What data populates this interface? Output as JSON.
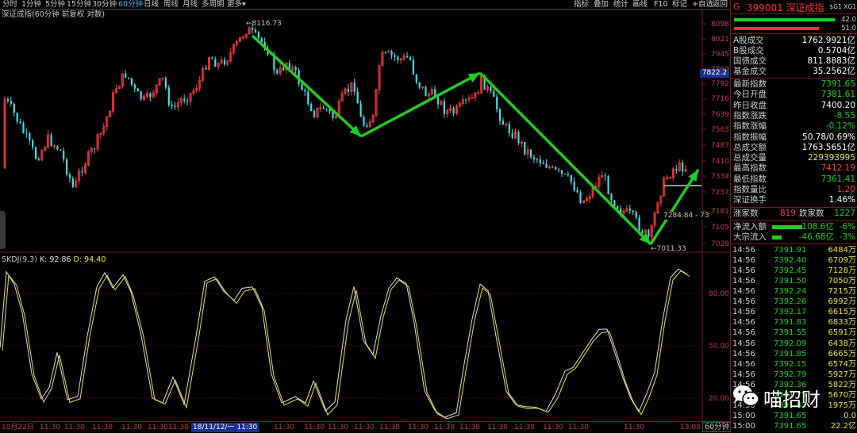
{
  "toolbar": {
    "timeframes": [
      "分时",
      "1分钟",
      "5分钟",
      "15分钟",
      "30分钟",
      "60分钟",
      "日线",
      "周线",
      "月线",
      "多周期",
      "更多"
    ],
    "active": "60分钟",
    "tools": [
      "指标",
      "叠加",
      "统计",
      "画线",
      "F10",
      "标记",
      "+自选",
      "返回"
    ]
  },
  "chart": {
    "title": "深证成指(60分钟 前复权 对数)",
    "peak_label": "8116.73",
    "low_label": "7011.33",
    "right_label": "7284.84 - 73",
    "current_price": "7822.2",
    "y_ticks": [
      "8098",
      "8021",
      "7945",
      "7869",
      "7792",
      "7716",
      "7639",
      "7563",
      "7487",
      "7410",
      "7334",
      "7257",
      "7181",
      "7105",
      "7028"
    ],
    "kdj_title": "SKDJ(9,3)",
    "kdj_k": "K: 92.86",
    "kdj_d": "D: 94.40",
    "kdj_ticks": [
      "80.00",
      "50.00",
      "20.00"
    ],
    "x_labels": [
      "10月22日",
      "11:30",
      "11:30",
      "11:30",
      "11:30",
      "11:30",
      "11:30",
      "18/11/12/一 11:30",
      "11:30",
      "11:30",
      "11:30",
      "11:30",
      "11:30",
      "11:30",
      "11:30",
      "11:30",
      "11:30",
      "11:30",
      "11:30",
      "11:30",
      "11:30",
      "13:00"
    ],
    "period_label": "60分钟",
    "colors": {
      "up": "#ff3c3c",
      "down": "#40e0e8",
      "trend": "#22cc22",
      "k_line": "#e0e0e0",
      "d_line": "#e8e845"
    }
  },
  "panel": {
    "g": "G",
    "title": "399001 深证成指",
    "tag": "$G1 XG1",
    "bar_top_val": "42.0",
    "bar_bottom_val": "51.0",
    "volumes": [
      {
        "label": "A股成交",
        "value": "1762.9921亿"
      },
      {
        "label": "B股成交",
        "value": "0.5704亿"
      },
      {
        "label": "国债成交",
        "value": "811.8883亿"
      },
      {
        "label": "基金成交",
        "value": "35.2562亿"
      }
    ],
    "quotes": [
      {
        "label": "最新指数",
        "value": "7391.65",
        "color": "green"
      },
      {
        "label": "今日开盘",
        "value": "7381.61",
        "color": "green"
      },
      {
        "label": "昨日收盘",
        "value": "7400.20",
        "color": "white"
      },
      {
        "label": "指数涨跌",
        "value": "-8.55",
        "color": "green"
      },
      {
        "label": "指数涨幅",
        "value": "-0.12%",
        "color": "green"
      },
      {
        "label": "指数振幅",
        "value": "50.78/0.69%",
        "color": "white"
      },
      {
        "label": "总成交额",
        "value": "1763.5651亿",
        "color": "white"
      },
      {
        "label": "总成交量",
        "value": "229393995",
        "color": "yellow"
      },
      {
        "label": "最高指数",
        "value": "7412.19",
        "color": "red"
      },
      {
        "label": "最低指数",
        "value": "7361.41",
        "color": "green"
      },
      {
        "label": "指数量比",
        "value": "1.20",
        "color": "red"
      },
      {
        "label": "深证换手",
        "value": "1.46%",
        "color": "white"
      }
    ],
    "breadth": {
      "up_label": "涨家数",
      "up": "819",
      "down_label": "跌家数",
      "down": "1227"
    },
    "flows": [
      {
        "label": "净流入额",
        "value": "-108.6亿",
        "pct": "-6%"
      },
      {
        "label": "大宗流入",
        "value": "-46.68亿",
        "pct": "-3%"
      }
    ],
    "ticks": [
      {
        "t": "14:56",
        "p": "7391.91",
        "q": "6484万"
      },
      {
        "t": "14:56",
        "p": "7392.40",
        "q": "6709万"
      },
      {
        "t": "14:56",
        "p": "7392.45",
        "q": "7128万"
      },
      {
        "t": "14:56",
        "p": "7391.50",
        "q": "7050万"
      },
      {
        "t": "14:56",
        "p": "7392.24",
        "q": "7215万"
      },
      {
        "t": "14:56",
        "p": "7392.26",
        "q": "6992万"
      },
      {
        "t": "14:56",
        "p": "7392.17",
        "q": "6615万"
      },
      {
        "t": "14:56",
        "p": "7391.83",
        "q": "6833万"
      },
      {
        "t": "14:56",
        "p": "7391.55",
        "q": "6591万"
      },
      {
        "t": "14:56",
        "p": "7392.09",
        "q": "6438万"
      },
      {
        "t": "14:56",
        "p": "7391.85",
        "q": "6665万"
      },
      {
        "t": "14:56",
        "p": "7392.15",
        "q": "6574万"
      },
      {
        "t": "14:56",
        "p": "7392.79",
        "q": "5927万"
      },
      {
        "t": "14:56",
        "p": "7392.36",
        "q": "5822万"
      },
      {
        "t": "14:56",
        "p": "7391.75",
        "q": "5670万"
      },
      {
        "t": "14:56",
        "p": "7391.83",
        "q": "1975万"
      },
      {
        "t": "15:00",
        "p": "7391.65",
        "q": "0.0"
      },
      {
        "t": "15:00",
        "p": "7391.65",
        "q": "22.2亿"
      }
    ]
  },
  "watermark": {
    "text": "喵招财",
    "icon": "wechat-icon"
  }
}
